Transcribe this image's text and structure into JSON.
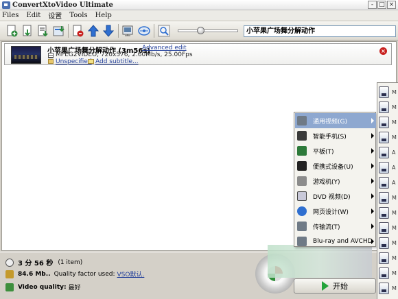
{
  "window": {
    "title": "ConvertXtoVideo Ultimate",
    "controls": [
      "-",
      "□",
      "×"
    ]
  },
  "menubar": {
    "items": [
      "Files",
      "Edit",
      "设置",
      "Tools",
      "Help"
    ]
  },
  "toolbar": {
    "buttons": [
      {
        "name": "add-file-icon",
        "color": "#2d8a3c"
      },
      {
        "name": "add-folder-icon",
        "color": "#2d8a3c"
      },
      {
        "name": "import-icon",
        "color": "#2d8a3c"
      },
      {
        "name": "import-dvd-icon",
        "color": "#2d8a3c"
      },
      {
        "name": "remove-icon",
        "color": "#c8201e"
      },
      {
        "name": "move-up-icon",
        "color": "#2f6fd0"
      },
      {
        "name": "move-down-icon",
        "color": "#2f6fd0"
      },
      {
        "name": "settings-icon",
        "color": "#5a7fa8"
      },
      {
        "name": "refresh-icon",
        "color": "#5a7fa8"
      },
      {
        "name": "preview-icon",
        "color": "#5a7fa8"
      }
    ],
    "title_input": "小苹果广场舞分解动作"
  },
  "item": {
    "title": "小苹果广场舞分解动作 (3m56s)",
    "advanced_edit": "Advanced edit",
    "meta": "MPEG2VIDEO, 720x576, 2.60Mb/s, 25.00Fps",
    "audio": "Unspecified",
    "subtitle": "Add subtitle..."
  },
  "bottom": {
    "duration": "3 分 56 秒",
    "items": "(1 item)",
    "size": "84.6 Mb..",
    "quality_factor_label": "Quality factor used:",
    "quality_factor_value": "VSO默认.",
    "video_quality_label": "Video quality:",
    "video_quality_value": "最好",
    "start_label": "开始"
  },
  "menu": {
    "items": [
      {
        "label": "通用视频(G)",
        "icon": "general-video-icon",
        "selected": true
      },
      {
        "label": "智能手机(S)",
        "icon": "smartphone-icon",
        "selected": false
      },
      {
        "label": "平板(T)",
        "icon": "tablet-icon",
        "selected": false
      },
      {
        "label": "便携式设备(U)",
        "icon": "portable-device-icon",
        "selected": false
      },
      {
        "label": "游戏机(Y)",
        "icon": "game-console-icon",
        "selected": false
      },
      {
        "label": "DVD 视频(D)",
        "icon": "dvd-icon",
        "selected": false
      },
      {
        "label": "网页设计(W)",
        "icon": "web-design-icon",
        "selected": false
      },
      {
        "label": "传输流(T)",
        "icon": "transport-stream-icon",
        "selected": false
      },
      {
        "label": "Blu-ray and AVCHD",
        "icon": "bluray-icon",
        "selected": false
      }
    ]
  },
  "submenu": {
    "items": [
      {
        "label": "M",
        "icon": "dvd-format-icon"
      },
      {
        "label": "M",
        "icon": "dvd-format-icon"
      },
      {
        "label": "M",
        "icon": "dvd-format-icon"
      },
      {
        "label": "M",
        "icon": "dvd-format-icon"
      },
      {
        "label": "A",
        "icon": "avi-format-icon"
      },
      {
        "label": "A",
        "icon": "avi-format-icon"
      },
      {
        "label": "A",
        "icon": "avi-format-icon"
      },
      {
        "label": "M",
        "icon": "mkv-format-icon"
      },
      {
        "label": "M",
        "icon": "mkv-format-icon"
      },
      {
        "label": "M",
        "icon": "mkv-format-icon"
      },
      {
        "label": "M",
        "icon": "mkv-format-icon"
      },
      {
        "label": "M",
        "icon": "mkv-format-icon"
      },
      {
        "label": "M",
        "icon": "mkv-format-icon"
      },
      {
        "label": "M",
        "icon": "mkv-format-icon"
      }
    ]
  }
}
